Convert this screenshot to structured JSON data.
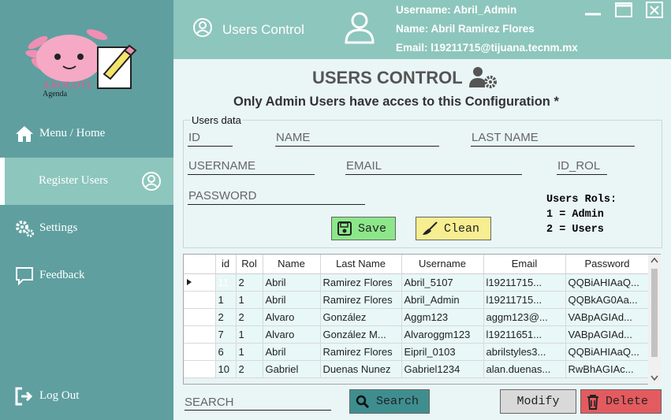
{
  "sidebar": {
    "logo_text": "AXOLOTL",
    "logo_sub": "Agenda",
    "items": [
      {
        "label": "Menu / Home",
        "icon": "home-icon"
      },
      {
        "label": "Register Users",
        "icon": "user-circle-icon"
      },
      {
        "label": "Settings",
        "icon": "gears-icon"
      },
      {
        "label": "Feedback",
        "icon": "chat-bubble-icon"
      }
    ],
    "logout": "Log Out"
  },
  "header": {
    "title": "Users Control",
    "username": "Username: Abril_Admin",
    "name": "Name: Abril  Ramirez Flores",
    "email": "Email: l19211715@tijuana.tecnm.mx"
  },
  "main": {
    "title": "USERS CONTROL",
    "subtitle": "Only Admin Users have acces to this Configuration *",
    "group_label": "Users data",
    "fields": {
      "id": "ID",
      "name": "NAME",
      "last_name": "LAST NAME",
      "username": "USERNAME",
      "email": "EMAIL",
      "id_rol": "ID_ROL",
      "password": "PASSWORD"
    },
    "rols": [
      "Users Rols:",
      "1 = Admin",
      "2 = Users"
    ],
    "save": "Save",
    "clean": "Clean",
    "search_placeholder": "SEARCH",
    "search_btn": "Search",
    "modify": "Modify",
    "delete": "Delete"
  },
  "table": {
    "columns": [
      "id",
      "Rol",
      "Name",
      "Last Name",
      "Username",
      "Email",
      "Password"
    ],
    "rows": [
      [
        "11",
        "2",
        "Abril",
        "Ramirez Flores",
        "Abril_5107",
        "l19211715...",
        "QQBiAHIAaQ..."
      ],
      [
        "1",
        "1",
        "Abril",
        "Ramirez Flores",
        "Abril_Admin",
        "l19211715...",
        "QQBkAG0Aa..."
      ],
      [
        "2",
        "2",
        "Alvaro",
        "González",
        "Aggm123",
        "aggm123@...",
        "VABpAGIAd..."
      ],
      [
        "7",
        "1",
        "Alvaro",
        "González M...",
        "Alvaroggm123",
        "l19211651...",
        "VABpAGIAd..."
      ],
      [
        "6",
        "1",
        "Abril",
        "Ramirez Flores",
        "Eipril_0103",
        "abrilstyles3...",
        "QQBiAHIAaQ..."
      ],
      [
        "10",
        "2",
        "Gabriel",
        "Duenas Nunez",
        "Gabriel1234",
        "alan.duenas...",
        "RwBhAGIAc..."
      ]
    ]
  },
  "colors": {
    "sidebar": "#5f9fa0",
    "header": "#8dc6bd",
    "save_btn": "#8ce78a",
    "clean_btn": "#f6ee90",
    "search_btn": "#3e8e8f",
    "delete_btn": "#e35b5f"
  }
}
